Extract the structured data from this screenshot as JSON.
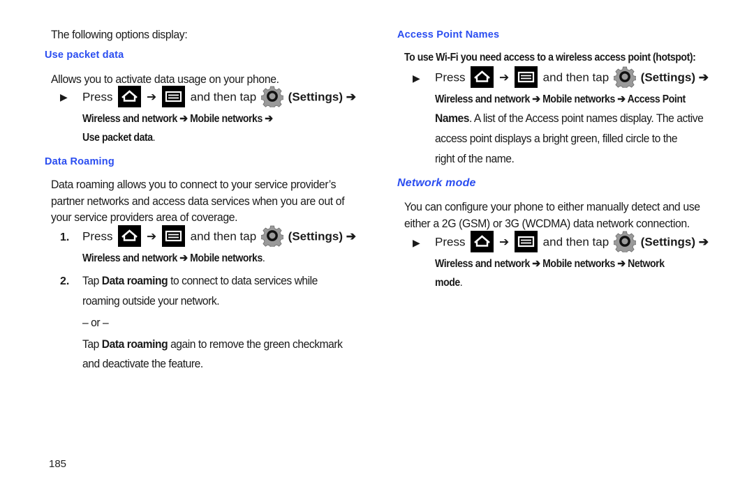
{
  "left": {
    "intro": "The following options display:",
    "sections": {
      "packet": {
        "heading": "Use packet data",
        "desc": "Allows you to activate data usage on your phone.",
        "step": {
          "bullet": "▶",
          "press": "Press",
          "arrow": "➔",
          "then_tap": "and then tap",
          "settings": "(Settings) ➔",
          "path_line1": "Wireless and network ➔ Mobile networks ➔",
          "path_line2_bold": "Use packet data",
          "path_line2_end": "."
        }
      },
      "roaming": {
        "heading": "Data Roaming",
        "desc_lines": [
          "Data roaming allows you to connect to your service provider’s",
          "partner networks and access data services when you are out of",
          "your service providers area of coverage."
        ],
        "step1": {
          "num": "1.",
          "press": "Press",
          "arrow": "➔",
          "then_tap": "and then tap",
          "settings": "(Settings) ➔",
          "path_bold": "Wireless and network ➔ Mobile networks",
          "path_end": "."
        },
        "step2": {
          "num": "2.",
          "tap": "Tap",
          "bold": "Data roaming",
          "rest_line1": "to connect to data services while",
          "line2": "roaming outside your network.",
          "or": "– or –",
          "alt_tap": "Tap",
          "alt_bold": "Data roaming",
          "alt_rest": "again to remove the green checkmark",
          "alt_line2": "and deactivate the feature."
        }
      }
    }
  },
  "right": {
    "apn": {
      "heading": "Access Point Names",
      "intro": "To use Wi-Fi you need access to a wireless access point (hotspot):",
      "step": {
        "bullet": "▶",
        "press": "Press",
        "arrow": "➔",
        "then_tap": "and then tap",
        "settings": "(Settings) ➔",
        "path_line1": "Wireless and network ➔ Mobile networks ➔ Access Point",
        "path_line2_bold": "Names",
        "path_line2_rest": ". A list of the Access point names display. The active",
        "line3": "access point displays a bright green, filled circle to the",
        "line4": "right of the name."
      }
    },
    "network_mode": {
      "heading": "Network mode",
      "desc_lines": [
        "You can configure your phone to either manually detect and use",
        "either a 2G (GSM) or 3G (WCDMA) data network connection."
      ],
      "step": {
        "bullet": "▶",
        "press": "Press",
        "arrow": "➔",
        "then_tap": "and then tap",
        "settings": "(Settings) ➔",
        "path_line1": "Wireless and network ➔ Mobile networks  ➔ Network",
        "path_line2_bold": "mode",
        "path_line2_end": "."
      }
    }
  },
  "footer": {
    "page_number": "185"
  },
  "colors": {
    "heading": "#2a4df0",
    "text": "#1a1a1a",
    "icon_bg": "#000000",
    "gear": "#9a9a9a"
  }
}
